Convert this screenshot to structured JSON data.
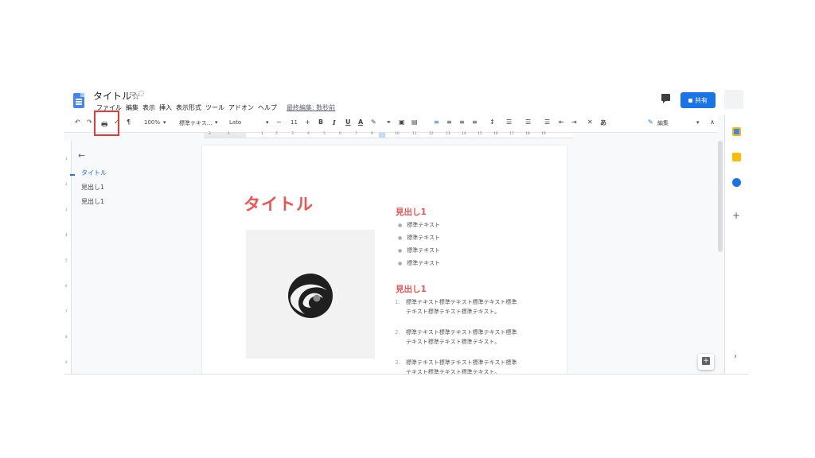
{
  "header": {
    "title": "タイトル",
    "menu": [
      "ファイル",
      "編集",
      "表示",
      "挿入",
      "表示形式",
      "ツール",
      "アドオン",
      "ヘルプ"
    ],
    "last_edit": "最終編集: 数秒前",
    "share_label": "共有"
  },
  "toolbar": {
    "zoom": "100%",
    "style": "標準テキス...",
    "font": "Lato",
    "font_size": "11",
    "bold": "B",
    "italic": "I",
    "underline": "U",
    "text_color": "A",
    "input_tools": "あ",
    "editing_mode": "編集",
    "highlighted_tool": "print-icon"
  },
  "ruler": {
    "labels": [
      "2",
      "1",
      "1",
      "2",
      "3",
      "4",
      "5",
      "6",
      "7",
      "8",
      "10",
      "11",
      "12",
      "13",
      "14",
      "15",
      "16",
      "17",
      "18",
      "19"
    ]
  },
  "vruler": {
    "labels": [
      "1",
      "2",
      "3",
      "4",
      "5",
      "6",
      "7",
      "8",
      "9"
    ]
  },
  "outline": {
    "items": [
      "タイトル",
      "見出し1",
      "見出し1"
    ]
  },
  "document": {
    "title": "タイトル",
    "heading1": "見出し1",
    "bullets": [
      "標準テキスト",
      "標準テキスト",
      "標準テキスト",
      "標準テキスト"
    ],
    "heading2": "見出し1",
    "numbered": [
      {
        "n": "1.",
        "text": "標準テキスト標準テキスト標準テキスト標準テキスト標準テキスト標準テキスト。"
      },
      {
        "n": "2.",
        "text": "標準テキスト標準テキスト標準テキスト標準テキスト標準テキスト標準テキスト。"
      },
      {
        "n": "3.",
        "text": "標準テキスト標準テキスト標準テキスト標準テキスト標準テキスト標準テキスト。"
      }
    ]
  },
  "colors": {
    "accent": "#ef5350",
    "highlight_box": "#e53935",
    "share_button": "#1a73e8",
    "doc_icon": "#4285f4"
  }
}
